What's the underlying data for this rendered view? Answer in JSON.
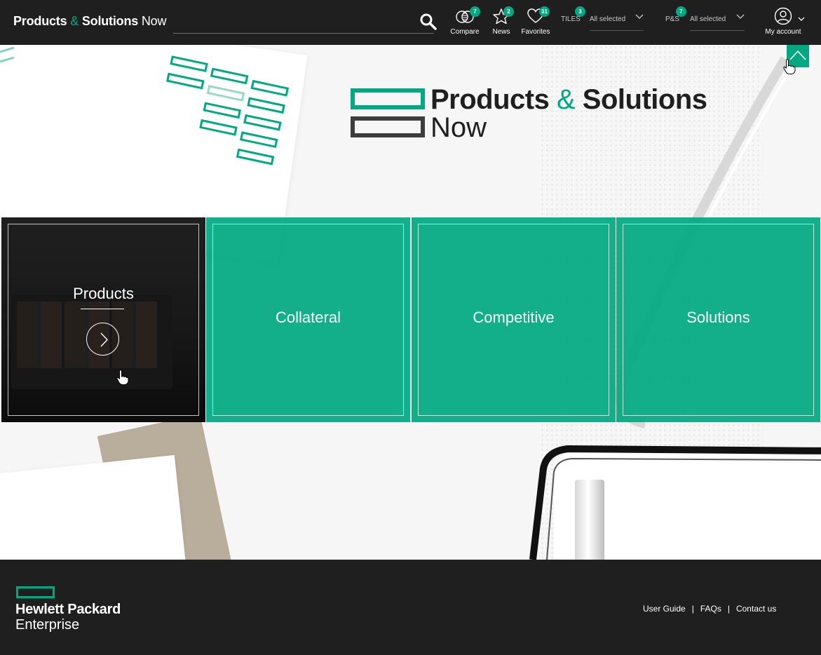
{
  "header": {
    "brand": {
      "part1": "Products",
      "amp": "&",
      "part2": "Solutions",
      "part3": "Now"
    },
    "search": {
      "placeholder": ""
    },
    "compare": {
      "label": "Compare",
      "count": "7"
    },
    "news": {
      "label": "News",
      "count": "2"
    },
    "favorites": {
      "label": "Favorites",
      "count": "31"
    },
    "tiles_filter": {
      "label": "TILES",
      "count": "3",
      "value": "All selected"
    },
    "ps_filter": {
      "label": "P&S",
      "count": "7",
      "value": "All selected"
    },
    "account": {
      "label": "My account"
    }
  },
  "hero": {
    "logo": {
      "line1a": "Products",
      "amp": "&",
      "line1b": "Solutions",
      "line2": "Now"
    }
  },
  "tiles": [
    {
      "label": "Products"
    },
    {
      "label": "Collateral"
    },
    {
      "label": "Competitive"
    },
    {
      "label": "Solutions"
    }
  ],
  "footer": {
    "company_line1": "Hewlett Packard",
    "company_line2": "Enterprise",
    "links": [
      "User Guide",
      "FAQs",
      "Contact us"
    ],
    "separator": "|"
  },
  "colors": {
    "accent": "#01a982",
    "dark": "#1f1f1f"
  },
  "icons": [
    "search-icon",
    "compare-icon",
    "news-star-icon",
    "favorites-heart-icon",
    "chevron-down-icon",
    "account-icon",
    "chevron-up-icon",
    "chevron-right-icon",
    "hand-cursor-icon"
  ]
}
